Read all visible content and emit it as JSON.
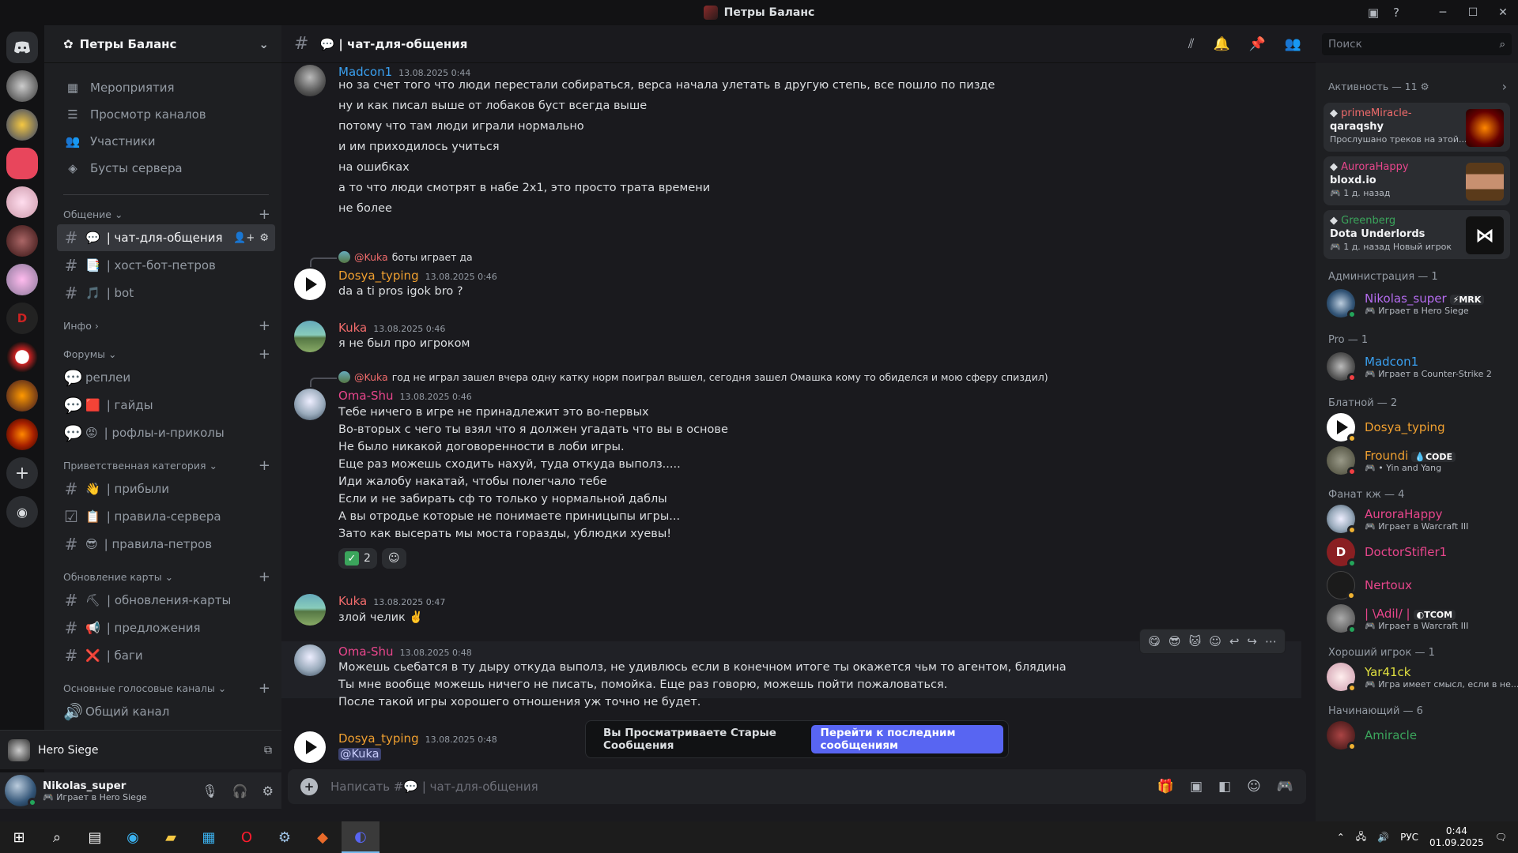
{
  "window": {
    "title": "Петры Баланс",
    "controls": [
      "─",
      "☐",
      "✕"
    ]
  },
  "guild": {
    "name": "Петры Баланс",
    "nav": [
      {
        "label": "Мероприятия",
        "icon": "calendar-icon"
      },
      {
        "label": "Просмотр каналов",
        "icon": "browse-channels-icon"
      },
      {
        "label": "Участники",
        "icon": "members-icon"
      },
      {
        "label": "Бусты сервера",
        "icon": "boost-icon"
      }
    ],
    "categories": [
      {
        "name": "Общение",
        "channels": [
          {
            "label": "| чат-для-общения",
            "emoji": "💬",
            "type": "text"
          },
          {
            "label": "| хост-бот-петров",
            "emoji": "📑",
            "type": "text"
          },
          {
            "label": "| bot",
            "emoji": "🎵",
            "type": "text"
          }
        ]
      },
      {
        "name": "Инфо",
        "channels": []
      },
      {
        "name": "Форумы",
        "channels": [
          {
            "label": "реплеи",
            "emoji": "",
            "type": "forum"
          },
          {
            "label": "| гайды",
            "emoji": "🟥",
            "type": "forum"
          },
          {
            "label": "| рофлы-и-приколы",
            "emoji": "😡",
            "type": "forum"
          }
        ]
      },
      {
        "name": "Приветственная категория",
        "channels": [
          {
            "label": "| прибыли",
            "emoji": "👋",
            "type": "text"
          },
          {
            "label": "| правила-сервера",
            "emoji": "📋",
            "type": "rules"
          },
          {
            "label": "| правила-петров",
            "emoji": "😎",
            "type": "text"
          }
        ]
      },
      {
        "name": "Обновление карты",
        "channels": [
          {
            "label": "| обновления-карты",
            "emoji": "⛏",
            "type": "text"
          },
          {
            "label": "| предложения",
            "emoji": "📢",
            "type": "text"
          },
          {
            "label": "| баги",
            "emoji": "❌",
            "type": "text"
          }
        ]
      },
      {
        "name": "Основные голосовые каналы",
        "channels": [
          {
            "label": "Общий канал",
            "emoji": "",
            "type": "voice"
          }
        ]
      }
    ]
  },
  "voice_activity": {
    "label": "Hero Siege"
  },
  "user": {
    "name": "Nikolas_super",
    "status": "Играет в Hero Siege"
  },
  "chat": {
    "channel_emoji": "💬",
    "channel_name": "| чат-для-общения",
    "composer_placeholder": "Написать #💬 | чат-для-общения",
    "jump_text": "Вы Просматриваете Старые Сообщения",
    "jump_button": "Перейти к последним сообщениям",
    "messages": [
      {
        "author": "Madcon1",
        "color": "#3aa0f0",
        "time": "13.08.2025 0:44",
        "avatar": "mad",
        "lines": [
          "но за счет того что люди перестали собираться, верса начала улетать в другую степь, все пошло по пизде",
          "ну и как писал выше от лобаков буст всегда выше",
          "потому что там люди играли нормально",
          "и им приходилось учиться",
          "на ошибках",
          "а то что люди смотрят в набе 2х1, это просто трата времени",
          "не более"
        ]
      },
      {
        "reply_to": "@Kuka",
        "reply_text": "боты играет да",
        "author": "Dosya_typing",
        "color": "#f0a030",
        "time": "13.08.2025 0:46",
        "avatar": "dos",
        "lines": [
          "da a ti pros igok bro ?"
        ]
      },
      {
        "author": "Kuka",
        "color": "#f06b6b",
        "time": "13.08.2025 0:46",
        "avatar": "kuka",
        "lines": [
          "я не был про игроком"
        ]
      },
      {
        "reply_to": "@Kuka",
        "reply_text": "год не играл зашел вчера одну катку норм поиграл вышел, сегодня зашел Омашка кому то обиделся и мою сферу спиздил)",
        "author": "Oma-Shu",
        "color": "#e8468c",
        "time": "13.08.2025 0:46",
        "avatar": "oma",
        "lines": [
          "Тебе ничего в игре не принадлежит это во-первых",
          "Во-вторых с чего ты взял что я должен угадать что вы в основе",
          "Не было никакой договоренности в лоби игры.",
          "Еще раз можешь сходить нахуй, туда откуда выполз.....",
          "Иди жалобу накатай, чтобы полегчало тебе",
          "Если и не забирать сф то только у нормальной даблы",
          "А вы отродье которые не понимаете приницыпы игры...",
          "Зато как высерать мы моста горазды, ублюдки хуевы!"
        ],
        "reaction_count": "2"
      },
      {
        "author": "Kuka",
        "color": "#f06b6b",
        "time": "13.08.2025 0:47",
        "avatar": "kuka",
        "lines": [
          "злой челик ✌️"
        ]
      },
      {
        "author": "Oma-Shu",
        "color": "#e8468c",
        "time": "13.08.2025 0:48",
        "avatar": "oma",
        "lines": [
          "Можешь сьебатся в ту дыру откуда выполз, не удивлюсь если в конечном итоге ты окажется чьм то агентом, блядина",
          "Ты мне вообще можешь ничего не писать, помойка. Еще раз говорю, можешь пойти пожаловаться.",
          "После такой игры хорошего отношения уж точно не будет."
        ]
      },
      {
        "author": "Dosya_typing",
        "color": "#f0a030",
        "time": "13.08.2025 0:48",
        "avatar": "dos",
        "lines": [
          "@Kuka"
        ]
      }
    ]
  },
  "search": {
    "placeholder": "Поиск"
  },
  "members": {
    "activity_header": "Активность — 11",
    "activities": [
      {
        "user": "primeMiracle-",
        "color": "#f06b6b",
        "game": "qaraqshy",
        "status": "Прослушано треков на этой...",
        "img": "fire"
      },
      {
        "user": "AuroraHappy",
        "color": "#e8468c",
        "game": "bloxd.io",
        "status": "1 д. назад",
        "img": "block"
      },
      {
        "user": "Greenberg",
        "color": "#3ba55c",
        "game": "Dota Underlords",
        "status": "1 д. назад   Новый игрок",
        "img": "underlords"
      }
    ],
    "groups": [
      {
        "header": "Администрация — 1",
        "members": [
          {
            "name": "Nikolas_super",
            "color": "#b56cf0",
            "tag": "⚡MRK",
            "sub": "Играет в Hero Siege",
            "av": "#357",
            "st": "#23a55a"
          }
        ]
      },
      {
        "header": "Pro — 1",
        "members": [
          {
            "name": "Madcon1",
            "color": "#3aa0f0",
            "tag": "",
            "sub": "Играет в Counter-Strike 2",
            "av": "#666",
            "st": "#f23f43"
          }
        ]
      },
      {
        "header": "Блатной — 2",
        "members": [
          {
            "name": "Dosya_typing",
            "color": "#f0a030",
            "tag": "",
            "sub": "",
            "av": "#fff",
            "st": "#f0b232"
          },
          {
            "name": "Froundi",
            "color": "#f0a030",
            "tag": "💧CODE",
            "sub": "• Yin and Yang",
            "av": "#554",
            "st": "#f23f43"
          }
        ]
      },
      {
        "header": "Фанат кж — 4",
        "members": [
          {
            "name": "AuroraHappy",
            "color": "#e8468c",
            "tag": "",
            "sub": "Играет в Warcraft III",
            "av": "#abc",
            "st": "#f0b232"
          },
          {
            "name": "DoctorStifler1",
            "color": "#e8468c",
            "tag": "",
            "sub": "",
            "av": "#a33",
            "st": "#23a55a"
          },
          {
            "name": "Nertoux",
            "color": "#e8468c",
            "tag": "",
            "sub": "",
            "av": "#222",
            "st": "#f0b232"
          },
          {
            "name": "| \\Adil/ |",
            "color": "#e8468c",
            "tag": "◐TCOM",
            "sub": "Играет в Warcraft III",
            "av": "#777",
            "st": "#23a55a"
          }
        ]
      },
      {
        "header": "Хороший игрок — 1",
        "members": [
          {
            "name": "Yar41ck",
            "color": "#e0e040",
            "tag": "",
            "sub": "Игра имеет смысл, если в не...",
            "av": "#ccb",
            "st": "#f0b232"
          }
        ]
      },
      {
        "header": "Начинающий — 6",
        "members": [
          {
            "name": "Amiracle",
            "color": "#3ba55c",
            "tag": "",
            "sub": "",
            "av": "#622",
            "st": "#f0b232"
          }
        ]
      }
    ]
  },
  "taskbar": {
    "lang": "РУС",
    "time": "0:44",
    "date": "01.09.2025"
  }
}
